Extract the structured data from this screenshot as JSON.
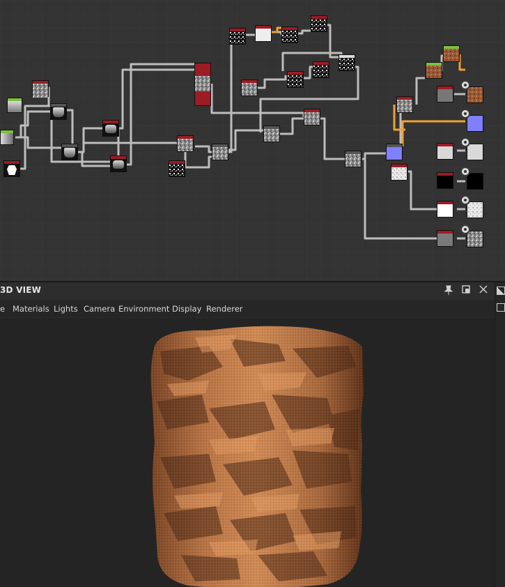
{
  "panel": {
    "title": "3D VIEW",
    "pin_icon": "pin-icon",
    "float_icon": "float-window-icon",
    "close_icon": "close-icon"
  },
  "menu": {
    "items": [
      "e",
      "Materials",
      "Lights",
      "Camera",
      "Environment",
      "Display",
      "Renderer"
    ]
  },
  "colors": {
    "graph_bg": "#333333",
    "wire": "#bdbdbd",
    "wire_selected": "#f0a030",
    "node_header_red": "#9c1b24",
    "node_header_green": "#7cc140",
    "viewport_bg": "#242424",
    "material": "#c07a48"
  },
  "icons": {
    "output": "output-node-icon",
    "viewport_mesh": "cylinder-preview"
  }
}
